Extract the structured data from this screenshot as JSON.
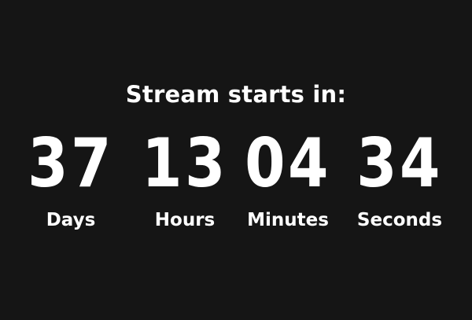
{
  "heading": "Stream starts in:",
  "countdown": [
    {
      "value": "37",
      "label": "Days"
    },
    {
      "value": "13",
      "label": "Hours"
    },
    {
      "value": "04",
      "label": "Minutes"
    },
    {
      "value": "34",
      "label": "Seconds"
    }
  ],
  "colors": {
    "background": "#151515",
    "text": "#ffffff"
  }
}
